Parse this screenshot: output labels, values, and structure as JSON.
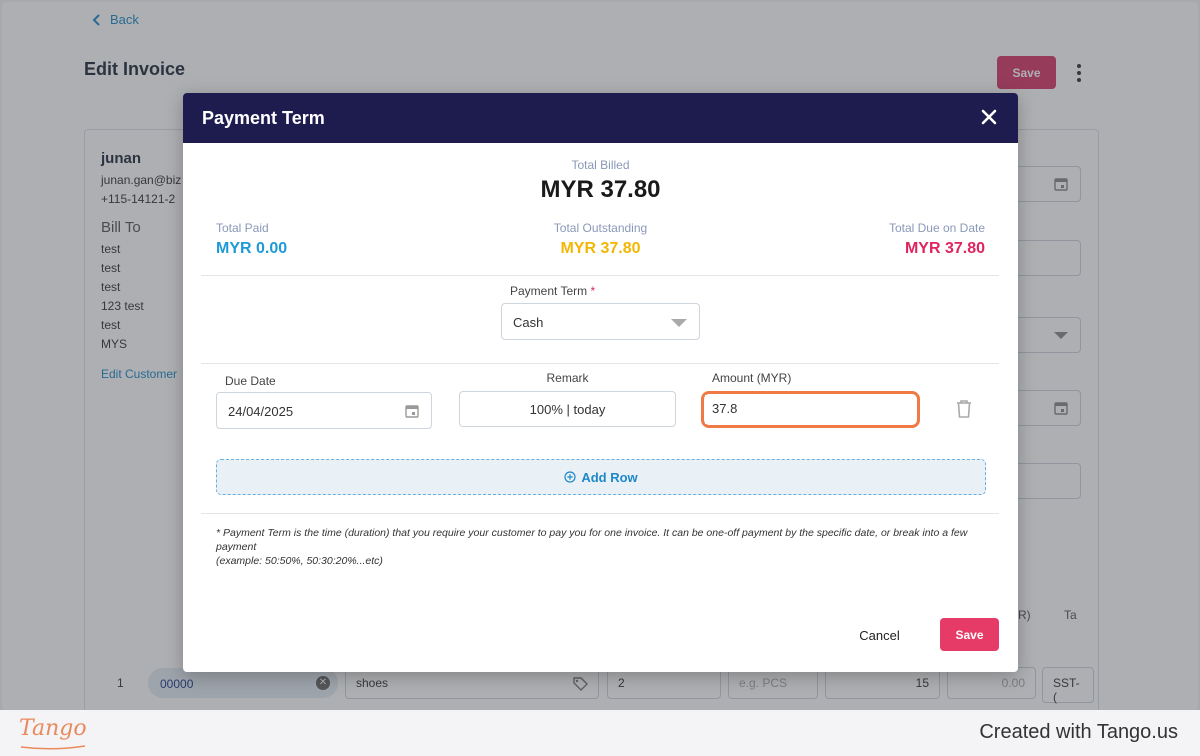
{
  "page": {
    "back_label": "Back",
    "title": "Edit Invoice",
    "save_label": "Save",
    "customer": {
      "name": "junan",
      "email": "junan.gan@biz",
      "phone": "+115-14121-2",
      "bill_to_label": "Bill To",
      "address_lines": [
        "test",
        "test",
        "test",
        "123 test",
        "test",
        "MYS"
      ],
      "edit_label": "Edit Customer"
    },
    "columns": [
      "R)",
      "Ta"
    ],
    "item_row": {
      "number": "1",
      "code": "00000",
      "description": "shoes",
      "quantity": "2",
      "unit_placeholder": "e.g. PCS",
      "price": "15",
      "discount": "0.00",
      "tax": "SST-("
    }
  },
  "modal": {
    "title": "Payment Term",
    "total_billed_label": "Total Billed",
    "total_billed_value": "MYR 37.80",
    "total_paid_label": "Total Paid",
    "total_paid_value": "MYR 0.00",
    "total_outstanding_label": "Total Outstanding",
    "total_outstanding_value": "MYR 37.80",
    "total_due_label": "Total Due on Date",
    "total_due_value": "MYR 37.80",
    "payment_term_label": "Payment Term",
    "payment_term_required": "*",
    "payment_term_value": "Cash",
    "due_date_label": "Due Date",
    "due_date_value": "24/04/2025",
    "remark_label": "Remark",
    "remark_value": "100% |  today",
    "amount_label": "Amount (MYR)",
    "amount_value": "37.8",
    "add_row_label": "Add Row",
    "note_line1": "* Payment Term is the time (duration) that you require your customer to pay you for one invoice. It can be one-off payment by the specific date, or break into a few payment",
    "note_line2": "(example: 50:50%, 50:30:20%...etc)",
    "cancel_label": "Cancel",
    "save_label": "Save",
    "colors": {
      "header_bg": "#1e1b4f",
      "paid": "#1e9bd7",
      "outstanding": "#f2b705",
      "due": "#e0245e",
      "save": "#e63b67",
      "highlight": "#f07a45"
    }
  },
  "footer": {
    "logo_text": "Tango",
    "created_text": "Created with Tango.us"
  }
}
